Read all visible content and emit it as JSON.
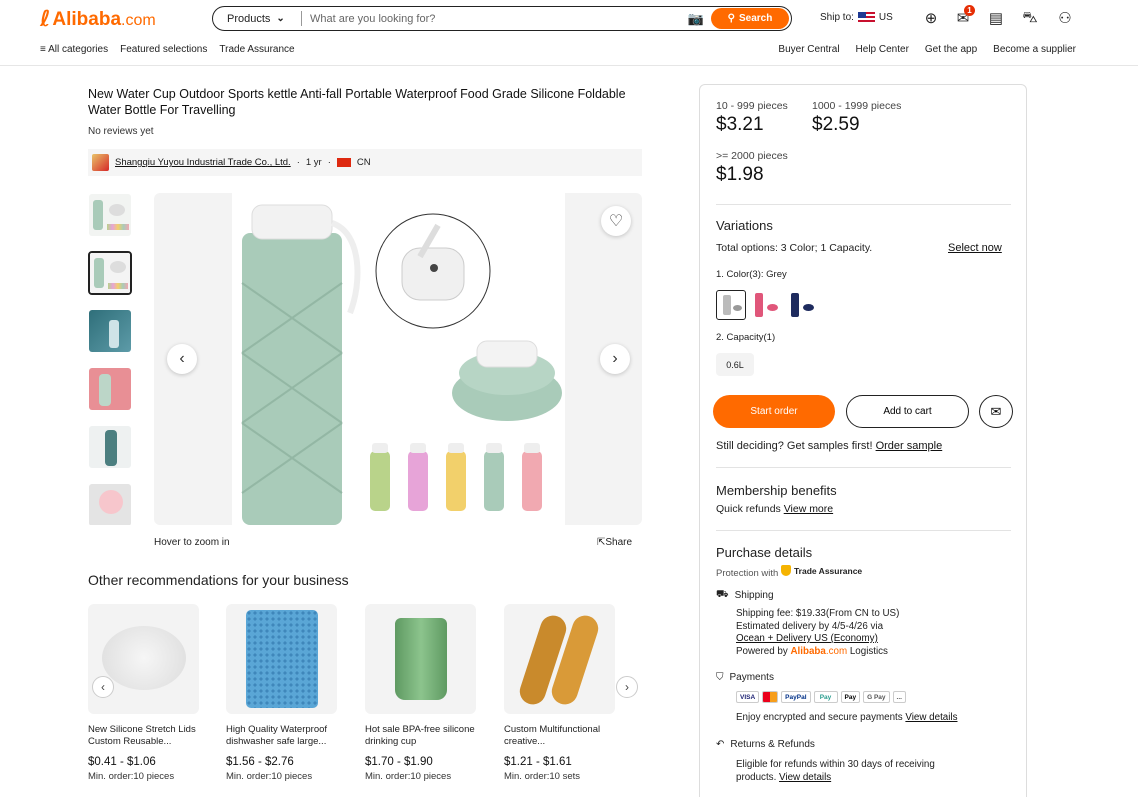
{
  "header": {
    "logo_text": "Alibaba",
    "logo_suffix": ".com",
    "search": {
      "category": "Products",
      "placeholder": "What are you looking for?",
      "button_label": "Search"
    },
    "ship_to_label": "Ship to:",
    "ship_to_country": "US",
    "messages_badge": "1"
  },
  "subnav": {
    "left": [
      "All categories",
      "Featured selections",
      "Trade Assurance"
    ],
    "right": [
      "Buyer Central",
      "Help Center",
      "Get the app",
      "Become a supplier"
    ]
  },
  "product": {
    "title": "New Water Cup Outdoor Sports kettle Anti-fall Portable Waterproof Food Grade Silicone Foldable Water Bottle For Travelling",
    "reviews": "No reviews yet",
    "supplier_name": "Shangqiu Yuyou Industrial Trade Co., Ltd.",
    "supplier_years": "1 yr",
    "supplier_country": "CN",
    "hover_zoom": "Hover to zoom in",
    "share": "Share"
  },
  "recommendations": {
    "title": "Other recommendations for your business",
    "items": [
      {
        "name": "New Silicone Stretch Lids Custom Reusable...",
        "price": "$0.41 - $1.06",
        "moq": "Min. order:10 pieces"
      },
      {
        "name": "High Quality Waterproof dishwasher safe large...",
        "price": "$1.56 - $2.76",
        "moq": "Min. order:10 pieces"
      },
      {
        "name": "Hot sale BPA-free silicone drinking cup",
        "price": "$1.70 - $1.90",
        "moq": "Min. order:10 pieces"
      },
      {
        "name": "Custom Multifunctional creative...",
        "price": "$1.21 - $1.61",
        "moq": "Min. order:10 sets"
      }
    ]
  },
  "pricing": {
    "tiers": [
      {
        "label": "10 - 999 pieces",
        "price": "$3.21"
      },
      {
        "label": "1000 - 1999 pieces",
        "price": "$2.59"
      },
      {
        "label": ">= 2000 pieces",
        "price": "$1.98"
      }
    ]
  },
  "variations": {
    "title": "Variations",
    "total": "Total options: 3 Color; 1 Capacity.",
    "select_now": "Select now",
    "color_label": "1. Color(3):",
    "color_selected": "Grey",
    "capacity_label": "2. Capacity(1)",
    "capacity_option": "0.6L"
  },
  "actions": {
    "start_order": "Start order",
    "add_to_cart": "Add to cart",
    "samples_text": "Still deciding? Get samples first!",
    "order_sample": "Order sample"
  },
  "membership": {
    "title": "Membership benefits",
    "text": "Quick refunds",
    "link": "View more"
  },
  "purchase": {
    "title": "Purchase details",
    "protection": "Protection with",
    "trade_assurance": "Trade Assurance",
    "shipping_title": "Shipping",
    "shipping_fee": "Shipping fee: $19.33(From CN to US)",
    "estimated": "Estimated delivery by 4/5-4/26 via",
    "method": "Ocean + Delivery US (Economy)",
    "powered_by": "Powered by",
    "logistics_brand": "Alibaba",
    "logistics_brand_suffix": ".com",
    "logistics": "Logistics",
    "payments_title": "Payments",
    "payment_methods": [
      "VISA",
      "MC",
      "PayPal",
      "Pay",
      "Pay",
      "G Pay",
      "..."
    ],
    "payments_text": "Enjoy encrypted and secure payments",
    "payments_link": "View details",
    "returns_title": "Returns & Refunds",
    "returns_text": "Eligible for refunds within 30 days of receiving products.",
    "returns_link": "View details"
  },
  "colors": {
    "brand_orange": "#ff6a00",
    "bottle_green": "#a9cbb9"
  }
}
